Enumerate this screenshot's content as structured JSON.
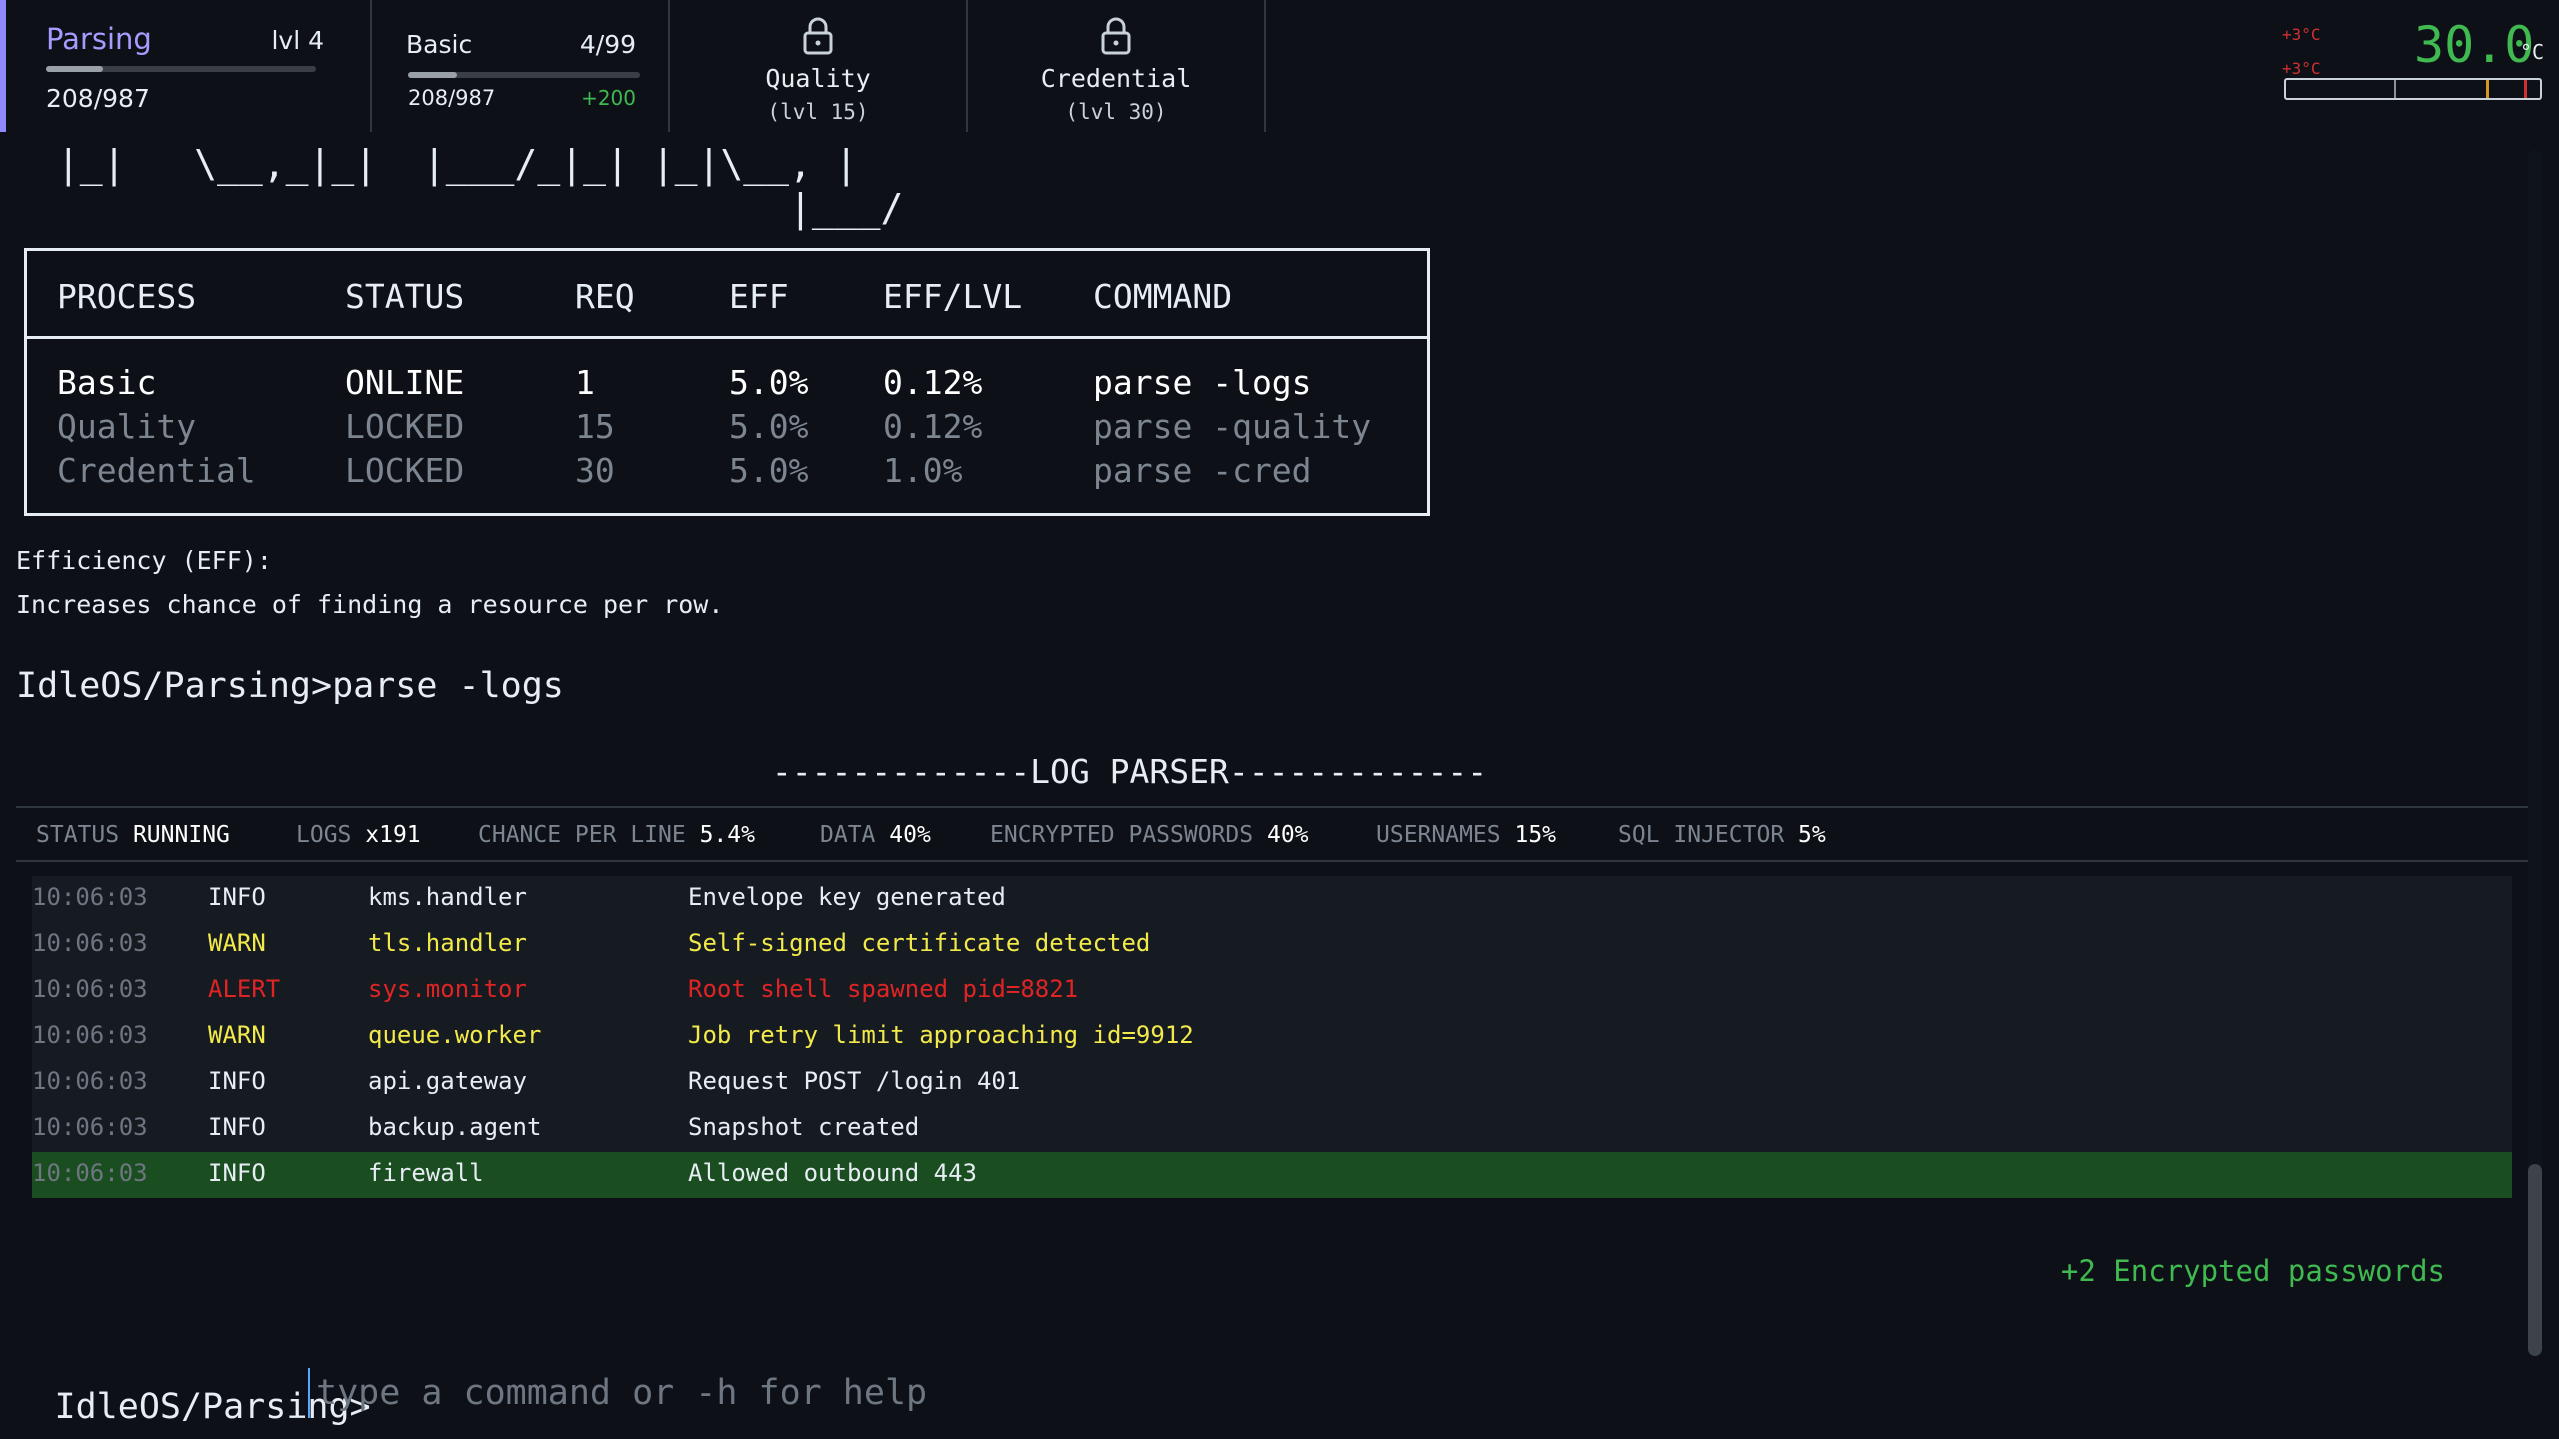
{
  "tabs": {
    "parsing": {
      "name": "Parsing",
      "level": "lvl 4",
      "count": "208/987",
      "progress": 0.21
    },
    "basic": {
      "name": "Basic",
      "ratio": "4/99",
      "count": "208/987",
      "bonus": "+200",
      "progress": 0.21
    },
    "quality": {
      "name": "Quality",
      "req": "(lvl 15)",
      "icon": "lock-icon"
    },
    "credential": {
      "name": "Credential",
      "req": "(lvl 30)",
      "icon": "lock-icon"
    }
  },
  "temperature": {
    "delta1": "+3°C",
    "delta2": "+3°C",
    "value": "30.0",
    "unit": "°C",
    "accent": "#3fb950"
  },
  "ascii_art": " |_|   \\__,_|_|  |___/_|_| |_|\\__, |\n                                 |___/",
  "process_table": {
    "headers": [
      "PROCESS",
      "STATUS",
      "REQ",
      "EFF",
      "EFF/LVL",
      "COMMAND"
    ],
    "rows": [
      [
        "Basic",
        "ONLINE",
        "1",
        "5.0%",
        "0.12%",
        "parse -logs"
      ],
      [
        "Quality",
        "LOCKED",
        "15",
        "5.0%",
        "0.12%",
        "parse -quality"
      ],
      [
        "Credential",
        "LOCKED",
        "30",
        "5.0%",
        "1.0%",
        "parse -cred"
      ]
    ]
  },
  "efficiency": {
    "title": "Efficiency (EFF):",
    "desc": "Increases chance of finding a resource per row."
  },
  "command_echo": "IdleOS/Parsing>parse -logs",
  "parser_title": "-------------LOG PARSER-------------",
  "stats": [
    {
      "label": "STATUS",
      "value": "RUNNING"
    },
    {
      "label": "LOGS",
      "value": "x191"
    },
    {
      "label": "CHANCE PER LINE",
      "value": "5.4%"
    },
    {
      "label": "DATA",
      "value": "40%"
    },
    {
      "label": "ENCRYPTED PASSWORDS",
      "value": "40%"
    },
    {
      "label": "USERNAMES",
      "value": "15%"
    },
    {
      "label": "SQL INJECTOR",
      "value": "5%"
    }
  ],
  "logs": [
    {
      "time": "10:06:03",
      "level": "INFO",
      "source": "kms.handler",
      "message": "Envelope key generated"
    },
    {
      "time": "10:06:03",
      "level": "WARN",
      "source": "tls.handler",
      "message": "Self-signed certificate detected"
    },
    {
      "time": "10:06:03",
      "level": "ALERT",
      "source": "sys.monitor",
      "message": "Root shell spawned pid=8821"
    },
    {
      "time": "10:06:03",
      "level": "WARN",
      "source": "queue.worker",
      "message": "Job retry limit approaching id=9912"
    },
    {
      "time": "10:06:03",
      "level": "INFO",
      "source": "api.gateway",
      "message": "Request POST /login 401"
    },
    {
      "time": "10:06:03",
      "level": "INFO",
      "source": "backup.agent",
      "message": "Snapshot created"
    },
    {
      "time": "10:06:03",
      "level": "INFO",
      "source": "firewall",
      "message": "Allowed outbound 443"
    }
  ],
  "reward": "+2 Encrypted passwords",
  "prompt": {
    "label": "IdleOS/Parsing>",
    "placeholder": "type a command or -h for help",
    "value": ""
  }
}
